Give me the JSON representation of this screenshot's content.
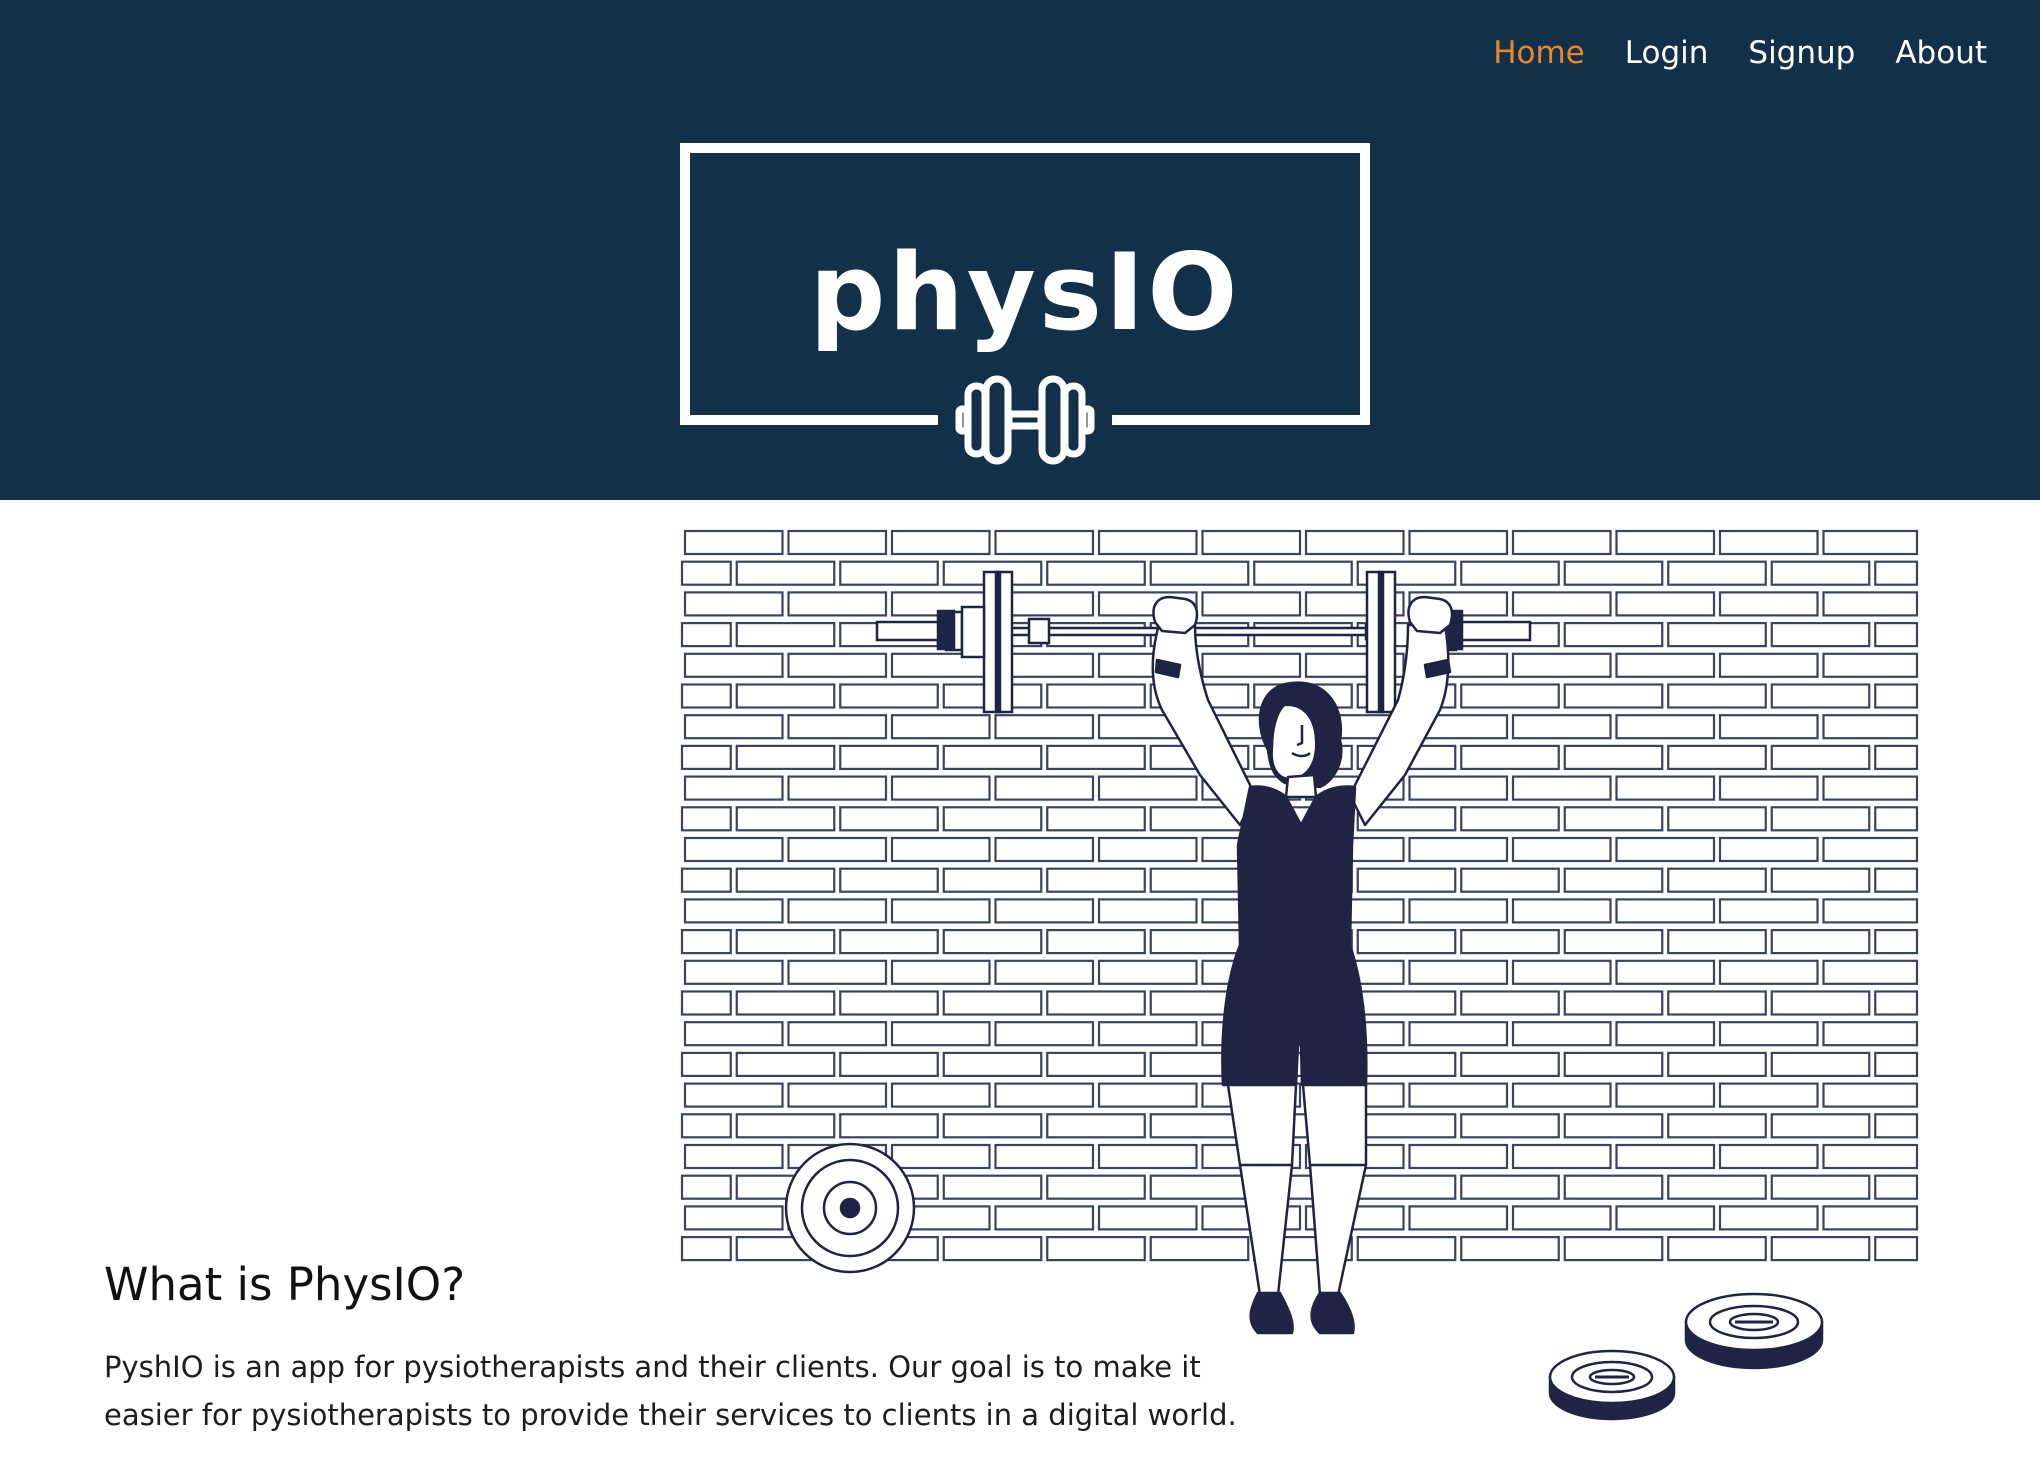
{
  "nav": {
    "items": [
      {
        "label": "Home",
        "active": true
      },
      {
        "label": "Login",
        "active": false
      },
      {
        "label": "Signup",
        "active": false
      },
      {
        "label": "About",
        "active": false
      }
    ]
  },
  "logo": {
    "text": "physIO",
    "icon": "dumbbell-icon"
  },
  "hero": {
    "illustration": "weightlifter-brick-wall-illustration"
  },
  "about": {
    "heading": "What is PhysIO?",
    "body": "PyshIO is an app for pysiotherapists and their clients. Our goal is to make it easier for pysiotherapists to provide their services to clients in a digital world."
  },
  "colors": {
    "header_bg": "#13304a",
    "nav_active": "#e8872c",
    "nav_text": "#ffffff",
    "illustration_ink": "#1f2444"
  }
}
